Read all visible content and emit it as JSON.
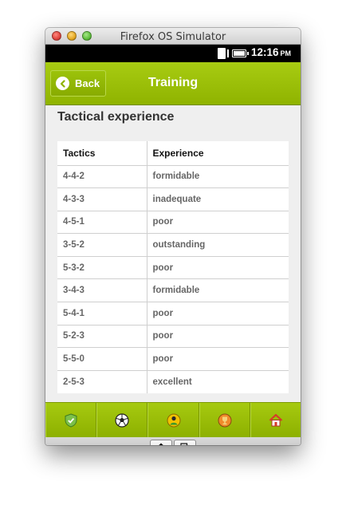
{
  "window": {
    "title": "Firefox OS Simulator"
  },
  "status": {
    "time": "12:16",
    "ampm": "PM"
  },
  "header": {
    "back_label": "Back",
    "title": "Training"
  },
  "section": {
    "title": "Tactical experience"
  },
  "table": {
    "columns": [
      "Tactics",
      "Experience"
    ],
    "rows": [
      [
        "4-4-2",
        "formidable"
      ],
      [
        "4-3-3",
        "inadequate"
      ],
      [
        "4-5-1",
        "poor"
      ],
      [
        "3-5-2",
        "outstanding"
      ],
      [
        "5-3-2",
        "poor"
      ],
      [
        "3-4-3",
        "formidable"
      ],
      [
        "5-4-1",
        "poor"
      ],
      [
        "5-2-3",
        "poor"
      ],
      [
        "5-5-0",
        "poor"
      ],
      [
        "2-5-3",
        "excellent"
      ]
    ]
  },
  "tabs": [
    {
      "icon": "shield-icon"
    },
    {
      "icon": "soccer-ball-icon"
    },
    {
      "icon": "player-icon"
    },
    {
      "icon": "trophy-icon"
    },
    {
      "icon": "home-icon"
    }
  ],
  "hardware": [
    {
      "icon": "home-icon"
    },
    {
      "icon": "windows-icon"
    }
  ],
  "colors": {
    "accent": "#9bbf08",
    "dark_accent": "#6f8a00",
    "background": "#efefef"
  }
}
